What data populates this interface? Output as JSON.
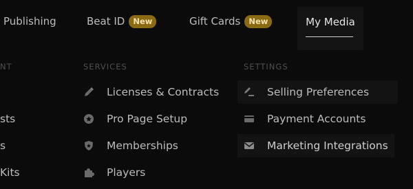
{
  "nav": {
    "tabs": [
      {
        "label": "Publishing"
      },
      {
        "label": "Beat ID",
        "badge": "New"
      },
      {
        "label": "Gift Cards",
        "badge": "New"
      },
      {
        "label": "My Media"
      }
    ]
  },
  "left_column": {
    "heading": "NT",
    "items": [
      "sts",
      "s",
      "Kits"
    ]
  },
  "services": {
    "heading": "SERVICES",
    "items": [
      {
        "label": "Licenses & Contracts",
        "icon": "pen-icon"
      },
      {
        "label": "Pro Page Setup",
        "icon": "star-badge-icon"
      },
      {
        "label": "Memberships",
        "icon": "shield-star-icon"
      },
      {
        "label": "Players",
        "icon": "puzzle-icon"
      }
    ]
  },
  "settings": {
    "heading": "SETTINGS",
    "items": [
      {
        "label": "Selling Preferences",
        "icon": "signature-icon"
      },
      {
        "label": "Payment Accounts",
        "icon": "card-icon"
      },
      {
        "label": "Marketing Integrations",
        "icon": "mail-icon"
      }
    ]
  },
  "colors": {
    "badge_bg": "#8a6a12",
    "badge_text": "#f4e3b0",
    "background": "#0b0b0b"
  }
}
